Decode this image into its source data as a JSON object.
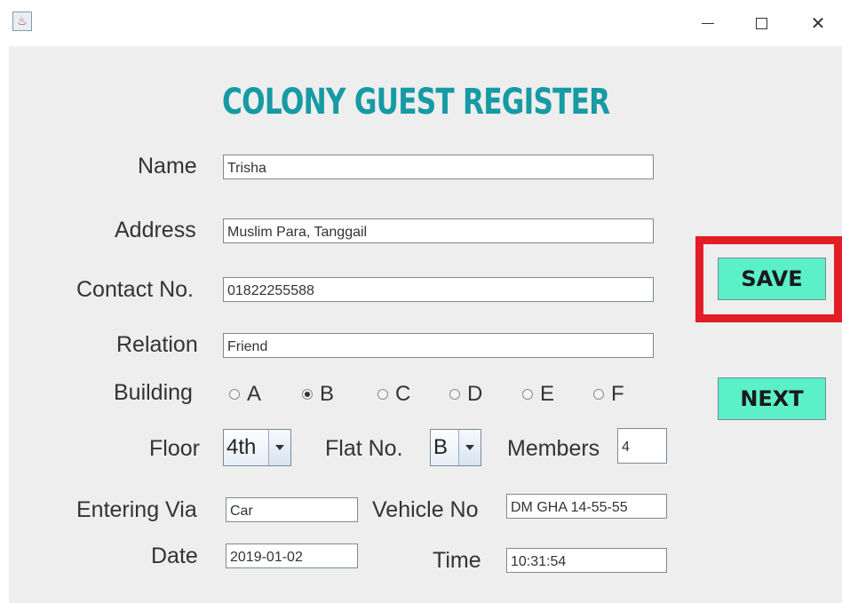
{
  "window": {
    "icon": "java-app-icon",
    "minimize_icon": "minimize-icon",
    "maximize_icon": "maximize-icon",
    "close_icon": "close-icon",
    "close_glyph": "✕"
  },
  "form": {
    "title": "COLONY GUEST REGISTER",
    "name": {
      "label": "Name",
      "value": "Trisha"
    },
    "address": {
      "label": "Address",
      "value": "Muslim Para, Tanggail"
    },
    "contact": {
      "label": "Contact No.",
      "value": "01822255588"
    },
    "relation": {
      "label": "Relation",
      "value": "Friend"
    },
    "building": {
      "label": "Building",
      "options": [
        "A",
        "B",
        "C",
        "D",
        "E",
        "F"
      ],
      "selected": "B"
    },
    "floor": {
      "label": "Floor",
      "value": "4th"
    },
    "flat": {
      "label": "Flat No.",
      "value": "B"
    },
    "members": {
      "label": "Members",
      "value": "4"
    },
    "entering_via": {
      "label": "Entering Via",
      "value": "Car"
    },
    "vehicle_no": {
      "label": "Vehicle No",
      "value": "DM GHA 14-55-55"
    },
    "date": {
      "label": "Date",
      "value": "2019-01-02"
    },
    "time": {
      "label": "Time",
      "value": "10:31:54"
    }
  },
  "buttons": {
    "save": "SAVE",
    "next": "NEXT"
  },
  "colors": {
    "title": "#169aa4",
    "button": "#5bf0c8",
    "highlight": "#e21d26"
  }
}
